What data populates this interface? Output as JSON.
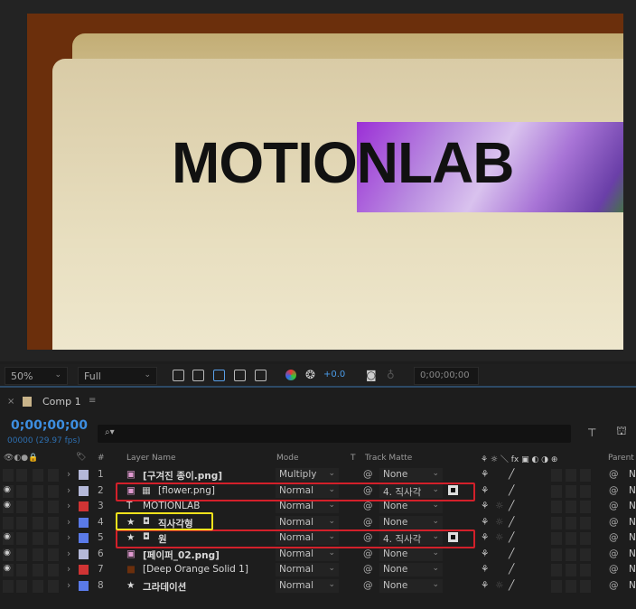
{
  "viewer": {
    "comp_title_text": "MOTIONLAB"
  },
  "toolbar": {
    "zoom": "50%",
    "resolution": "Full",
    "exposure": "+0.0",
    "timecode": "0;00;00;00"
  },
  "panel": {
    "close": "×",
    "tab": "Comp 1",
    "menu": "≡"
  },
  "time": {
    "current": "0;00;00;00",
    "frames": "00000 (29.97 fps)",
    "search_placeholder": "⌕▾"
  },
  "columns": {
    "hash": "#",
    "layer_name": "Layer Name",
    "mode": "Mode",
    "t": "T",
    "track_matte": "Track Matte",
    "switches": "⚘ ☼ ＼ fx ▣ ◐ ◑ ⊕",
    "parent": "Parent"
  },
  "layers": [
    {
      "num": "1",
      "name": "[구겨진 종이.png]",
      "mode": "Multiply",
      "matte": "None",
      "visible": false,
      "color": "#b4b8d8",
      "icon": "footage-icon"
    },
    {
      "num": "2",
      "name": "[flower.png]",
      "mode": "Normal",
      "matte": "4. 직사각",
      "visible": true,
      "color": "#b4b8d8",
      "icon": "footage-icon",
      "highlight": "red"
    },
    {
      "num": "3",
      "name": "MOTIONLAB",
      "mode": "Normal",
      "matte": "None",
      "visible": true,
      "color": "#d03434",
      "icon": "text-icon"
    },
    {
      "num": "4",
      "name": "직사각형",
      "mode": "Normal",
      "matte": "None",
      "visible": false,
      "color": "#5a7ae8",
      "icon": "shape-icon",
      "highlight": "yellow"
    },
    {
      "num": "5",
      "name": "원",
      "mode": "Normal",
      "matte": "4. 직사각",
      "visible": true,
      "color": "#5a7ae8",
      "icon": "shape-icon",
      "highlight": "red"
    },
    {
      "num": "6",
      "name": "[페이퍼_02.png]",
      "mode": "Normal",
      "matte": "None",
      "visible": true,
      "color": "#b4b8d8",
      "icon": "footage-icon"
    },
    {
      "num": "7",
      "name": "[Deep Orange Solid 1]",
      "mode": "Normal",
      "matte": "None",
      "visible": true,
      "color": "#d03434",
      "icon": "solid-icon"
    },
    {
      "num": "8",
      "name": "그라데이션",
      "mode": "Normal",
      "matte": "None",
      "visible": false,
      "color": "#5a7ae8",
      "icon": "shape-icon"
    }
  ],
  "parent_none": "N"
}
